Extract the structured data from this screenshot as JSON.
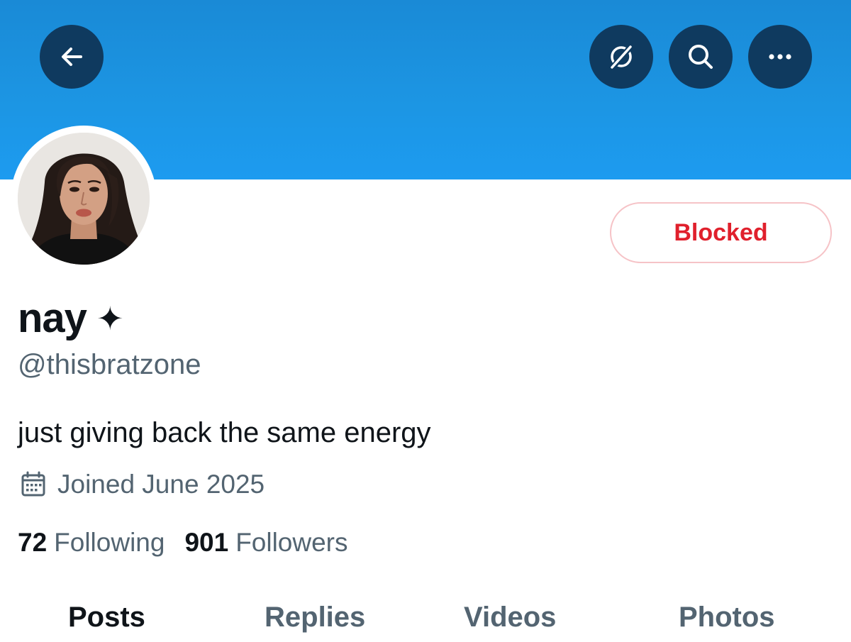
{
  "header": {
    "back_icon": "arrow-left-icon",
    "grok_icon": "grok-icon",
    "search_icon": "search-icon",
    "more_icon": "more-icon"
  },
  "profile": {
    "display_name": "nay",
    "name_emoji": "✦",
    "handle": "@thisbratzone",
    "bio": "just giving back the same energy",
    "joined": "Joined June 2025",
    "blocked_label": "Blocked",
    "following_count": "72",
    "following_label": "Following",
    "followers_count": "901",
    "followers_label": "Followers"
  },
  "tabs": [
    {
      "label": "Posts",
      "active": true
    },
    {
      "label": "Replies",
      "active": false
    },
    {
      "label": "Videos",
      "active": false
    },
    {
      "label": "Photos",
      "active": false
    }
  ],
  "colors": {
    "banner": "#1d9bf0",
    "header_button": "#0f3a5f",
    "blocked_text": "#e0202c",
    "blocked_border": "#f6c3c7",
    "secondary_text": "#536471",
    "primary_text": "#0f1419"
  }
}
